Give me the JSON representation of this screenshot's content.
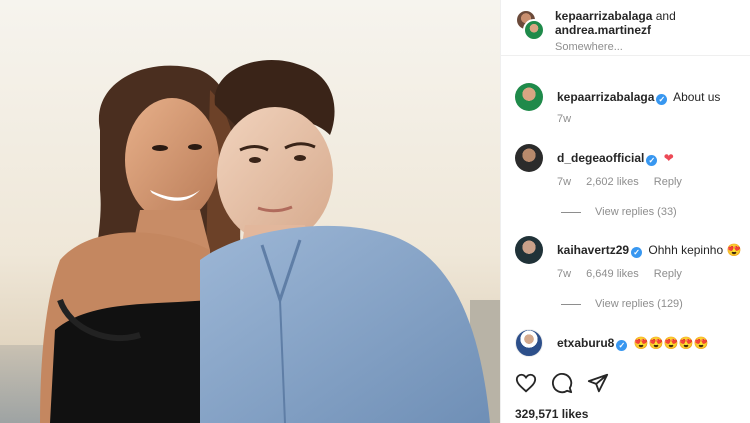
{
  "post": {
    "header": {
      "user1": "kepaarrizabalaga",
      "joiner": "and",
      "user2": "andrea.martinezf",
      "location": "Somewhere..."
    },
    "caption": {
      "username": "kepaarrizabalaga",
      "text": "About us",
      "time": "7w"
    },
    "comments": [
      {
        "username": "d_degeaofficial",
        "text": "❤",
        "time": "7w",
        "likes": "2,602 likes",
        "reply": "Reply",
        "view_replies": "View replies (33)"
      },
      {
        "username": "kaihavertz29",
        "text": "Ohhh kepinho 😍",
        "time": "7w",
        "likes": "6,649 likes",
        "reply": "Reply",
        "view_replies": "View replies (129)"
      },
      {
        "username": "etxaburu8",
        "text": "😍😍😍😍😍"
      }
    ],
    "likes": "329,571 likes",
    "icons": [
      "heart-icon",
      "comment-icon",
      "share-icon"
    ],
    "colors": {
      "verified": "#3897f0",
      "muted": "#8e8e8e",
      "heart": "#ed4956"
    }
  }
}
